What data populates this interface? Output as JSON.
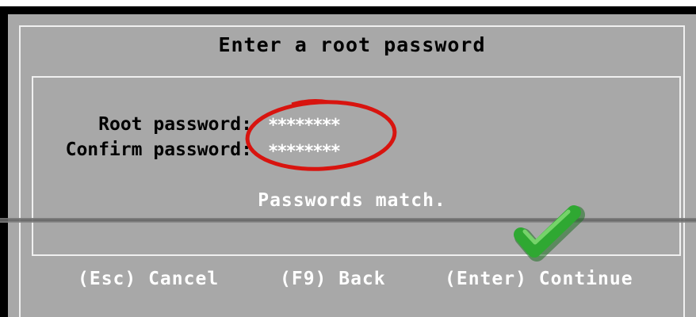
{
  "dialog": {
    "title": "Enter a root password",
    "fields": {
      "root_password_label": "Root password:",
      "root_password_value": "********",
      "confirm_password_label": "Confirm password:",
      "confirm_password_value": "********"
    },
    "status_message": "Passwords match.",
    "footer": {
      "cancel_label": "(Esc) Cancel",
      "back_label": "(F9) Back",
      "continue_label": "(Enter) Continue"
    }
  },
  "annotations": {
    "highlight_color": "#d8140f",
    "check_color": "#2fa832",
    "check_icon": "checkmark-icon"
  },
  "colors": {
    "dialog_background": "#a8a8a8",
    "text_dark": "#000000",
    "text_light": "#ffffff",
    "border": "#f0f0f0"
  }
}
